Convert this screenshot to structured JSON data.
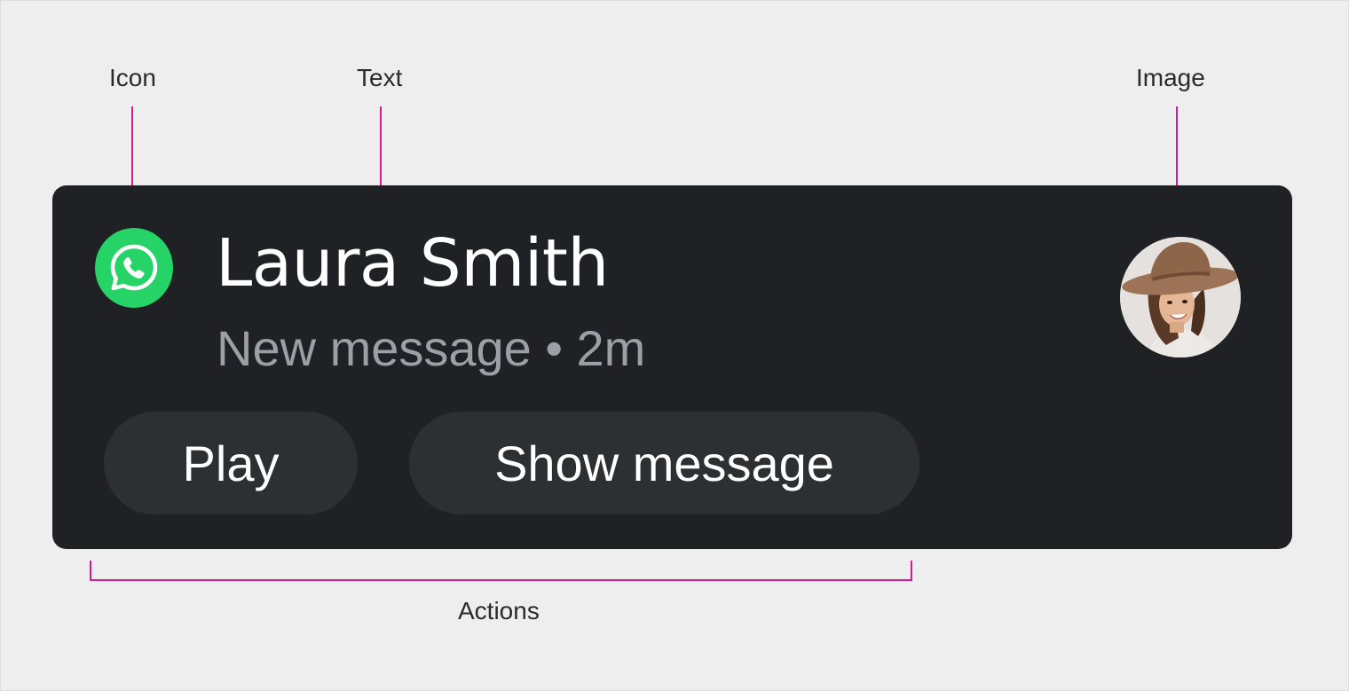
{
  "callouts": {
    "icon": "Icon",
    "text": "Text",
    "image": "Image",
    "actions": "Actions"
  },
  "notification": {
    "app_icon": "whatsapp-icon",
    "sender": "Laura Smith",
    "subtitle": "New message • 2m",
    "avatar": "avatar-image",
    "actions": [
      {
        "label": "Play"
      },
      {
        "label": "Show message"
      }
    ]
  },
  "colors": {
    "card_background": "#202124",
    "button_background": "#2d3033",
    "app_icon_green": "#26d366",
    "callout_accent": "#d81b8c",
    "subtitle_gray": "#9aa0a6"
  }
}
